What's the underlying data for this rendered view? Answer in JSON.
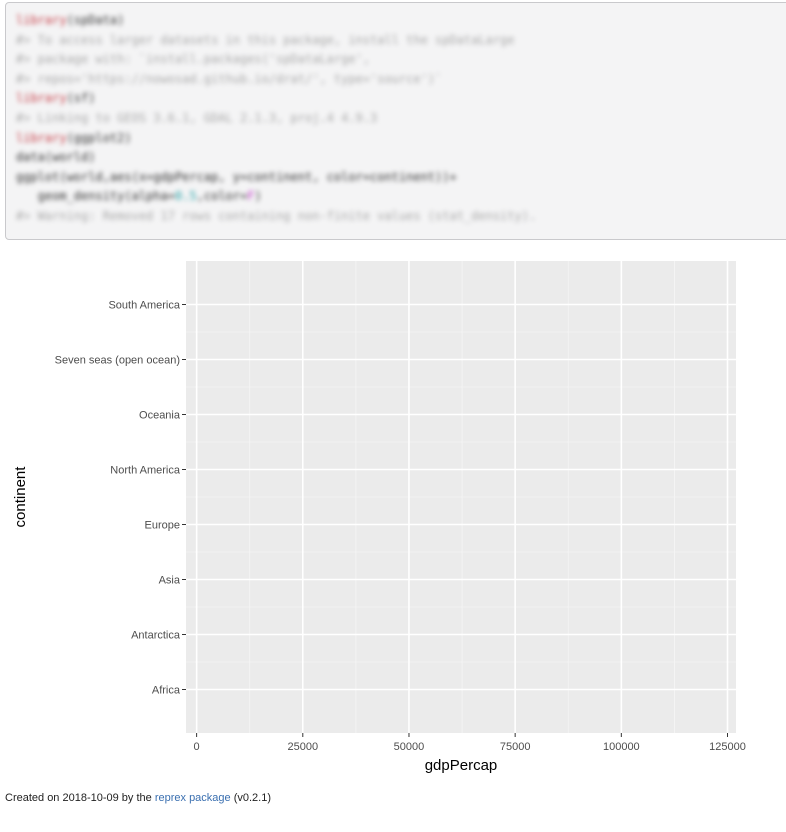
{
  "code": [
    [
      {
        "t": "library",
        "c": "kw"
      },
      {
        "t": "(spData)",
        "c": ""
      }
    ],
    [
      {
        "t": "#> To access larger datasets in this package, install the spDataLarge",
        "c": "cm"
      }
    ],
    [
      {
        "t": "#> package with: `install.packages('spDataLarge',",
        "c": "cm"
      }
    ],
    [
      {
        "t": "#> repos='https://nowosad.github.io/drat/', type='source')`",
        "c": "cm"
      }
    ],
    [
      {
        "t": "library",
        "c": "kw"
      },
      {
        "t": "(sf)",
        "c": ""
      }
    ],
    [
      {
        "t": "#> Linking to GEOS 3.6.1, GDAL 2.1.3, proj.4 4.9.3",
        "c": "cm"
      }
    ],
    [
      {
        "t": "library",
        "c": "kw"
      },
      {
        "t": "(ggplot2)",
        "c": ""
      }
    ],
    [
      {
        "t": "data(world)",
        "c": ""
      }
    ],
    [
      {
        "t": "ggplot(world,aes(x=gdpPercap, y=continent, color=continent))+",
        "c": ""
      }
    ],
    [
      {
        "t": "   geom_density(alpha=",
        "c": ""
      },
      {
        "t": "0.5",
        "c": "num"
      },
      {
        "t": ",color=",
        "c": ""
      },
      {
        "t": "F",
        "c": "str"
      },
      {
        "t": ")",
        "c": ""
      }
    ],
    [
      {
        "t": "#> Warning: Removed 17 rows containing non-finite values (stat_density).",
        "c": "cm"
      }
    ]
  ],
  "chart_data": {
    "type": "density",
    "categories": [
      "Africa",
      "Antarctica",
      "Asia",
      "Europe",
      "North America",
      "Oceania",
      "Seven seas (open ocean)",
      "South America"
    ],
    "x_ticks": [
      0,
      25000,
      50000,
      75000,
      100000,
      125000
    ],
    "x_tick_labels": [
      "0",
      "25000",
      "50000",
      "75000",
      "100000",
      "125000"
    ],
    "xlim": [
      -2500,
      127000
    ],
    "xlabel": "gdpPercap",
    "ylabel": "continent",
    "grid": true,
    "panel_bg": "#ebebeb",
    "grid_color": "#ffffff",
    "series": []
  },
  "footer": {
    "prefix": "Created on 2018-10-09 by the ",
    "link_text": "reprex package",
    "suffix": " (v0.2.1)"
  }
}
